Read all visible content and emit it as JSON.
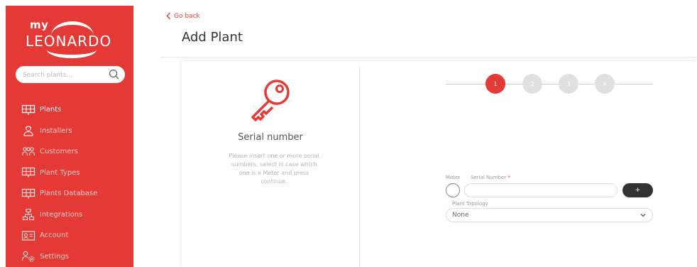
{
  "sidebar": {
    "logo_top": "my",
    "logo_brand": "LEONARDO",
    "search_placeholder": "Search plants...",
    "items": [
      {
        "label": "Plants",
        "icon": "solar-panel-icon",
        "active": true
      },
      {
        "label": "Installers",
        "icon": "installer-icon",
        "active": false
      },
      {
        "label": "Customers",
        "icon": "customers-icon",
        "active": false
      },
      {
        "label": "Plant Types",
        "icon": "solar-panel-icon",
        "active": false
      },
      {
        "label": "Plants Database",
        "icon": "solar-panel-icon",
        "active": false
      },
      {
        "label": "Integrations",
        "icon": "integrations-icon",
        "active": false
      },
      {
        "label": "Account",
        "icon": "account-card-icon",
        "active": false
      },
      {
        "label": "Settings",
        "icon": "settings-icon",
        "active": false
      }
    ]
  },
  "header": {
    "back_label": "Go back",
    "title": "Add Plant"
  },
  "step_info": {
    "title": "Serial number",
    "description": "Please insert one or more serial numbers, select in case which one is a Meter and press continue."
  },
  "stepper": {
    "steps": [
      "1",
      "2",
      "3",
      "4"
    ],
    "current": 1
  },
  "form": {
    "meter_label": "Meter",
    "serial_label": "Serial Number",
    "serial_required_mark": "*",
    "serial_value": "",
    "add_button_label": "+",
    "topology_label": "Plant Topology",
    "topology_value": "None"
  },
  "colors": {
    "brand_red": "#e53935",
    "dark_button": "#333333",
    "inactive_step": "#e0e0e0"
  }
}
